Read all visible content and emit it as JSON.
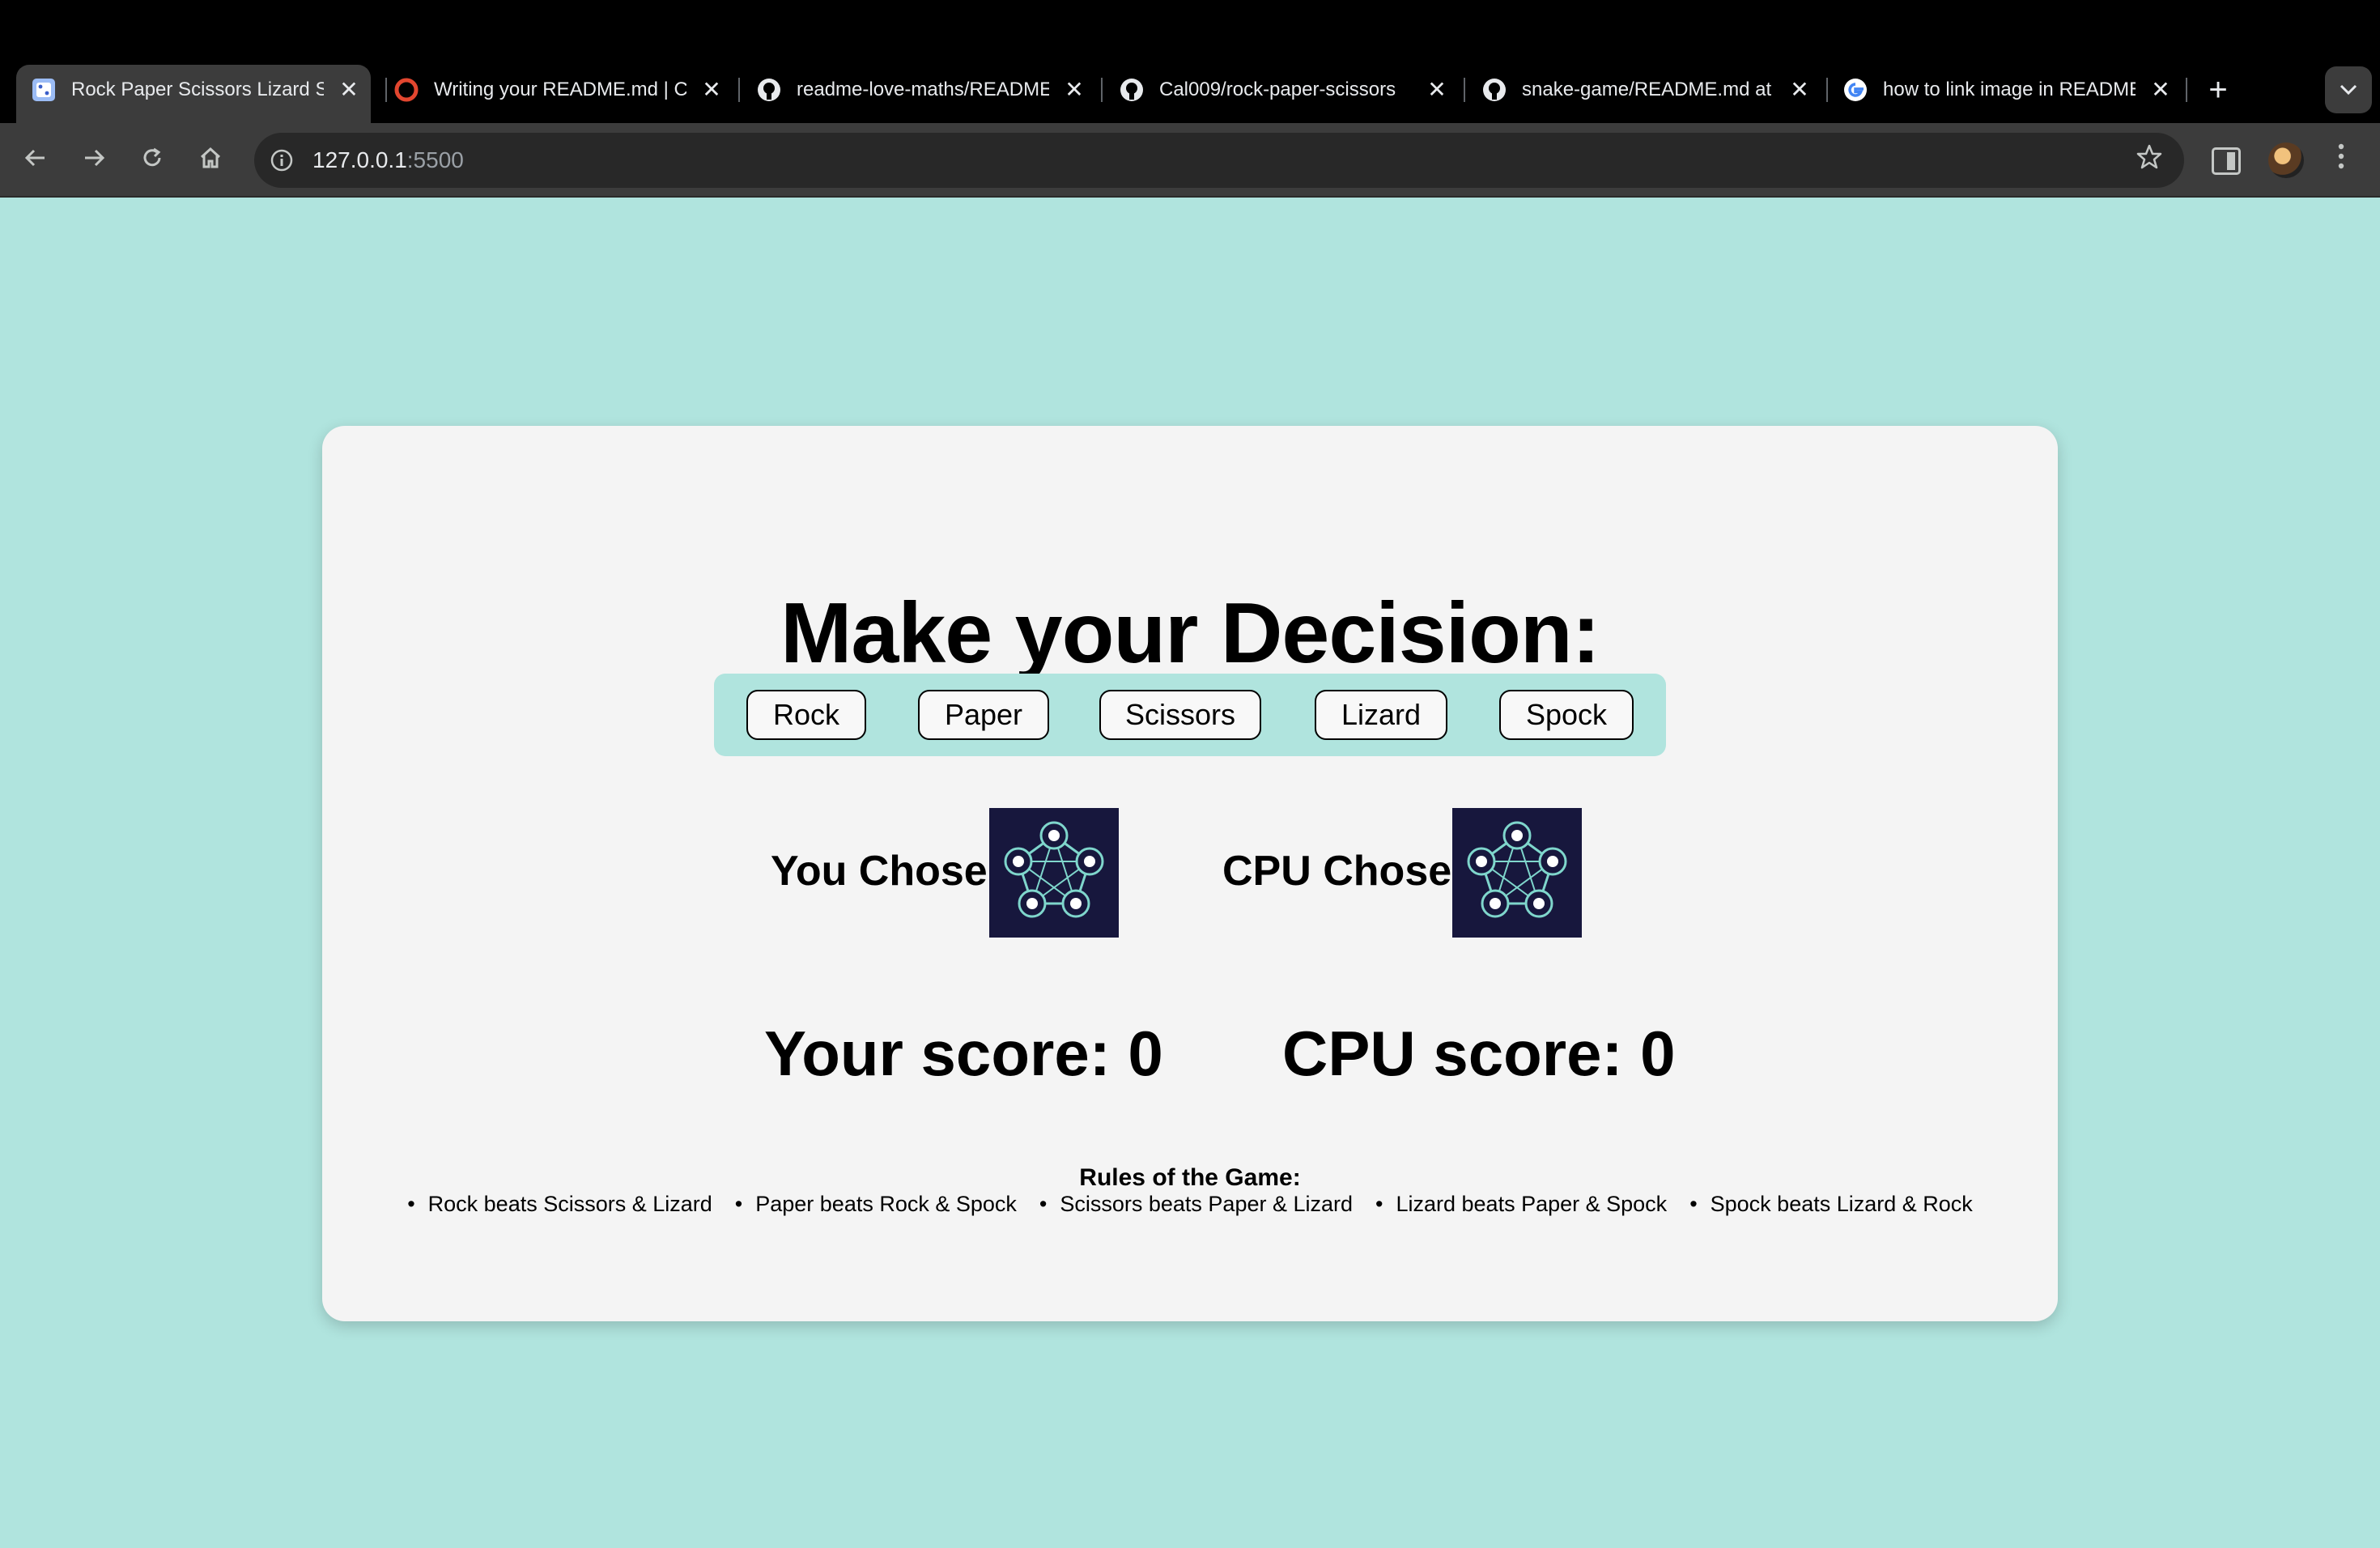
{
  "browser": {
    "tabs": [
      {
        "title": "Rock Paper Scissors Lizard Spock",
        "favicon": "game-icon",
        "active": true
      },
      {
        "title": "Writing your README.md | Code Institute",
        "favicon": "code-institute-icon",
        "active": false
      },
      {
        "title": "readme-love-maths/README.md",
        "favicon": "github-icon",
        "active": false
      },
      {
        "title": "Cal009/rock-paper-scissors",
        "favicon": "github-icon",
        "active": false
      },
      {
        "title": "snake-game/README.md at main",
        "favicon": "github-icon",
        "active": false
      },
      {
        "title": "how to link image in README.md",
        "favicon": "google-icon",
        "active": false
      }
    ],
    "close_glyph": "✕",
    "new_tab_glyph": "+",
    "url_host": "127.0.0.1",
    "url_port": ":5500"
  },
  "game": {
    "heading": "Make your Decision:",
    "choices": [
      "Rock",
      "Paper",
      "Scissors",
      "Lizard",
      "Spock"
    ],
    "you_chose_label": "You Chose:",
    "cpu_chose_label": "CPU Chose:",
    "your_score_label": "Your score: 0",
    "cpu_score_label": "CPU score: 0",
    "rules_title": "Rules of the Game:",
    "rules": [
      "Rock beats Scissors & Lizard",
      "Paper beats Rock & Spock",
      "Scissors beats Paper & Lizard",
      "Lizard beats Paper & Spock",
      "Spock beats Lizard & Rock"
    ]
  },
  "colors": {
    "page_background": "#b0e4de",
    "card_background": "#f4f4f4",
    "image_background": "#17173d",
    "image_accent": "#7fd6cc"
  }
}
